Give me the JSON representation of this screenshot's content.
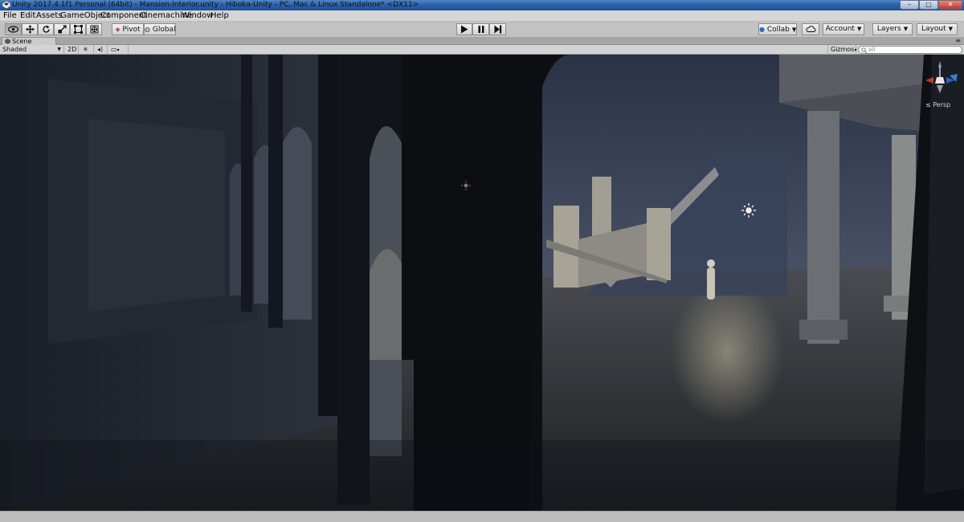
{
  "window": {
    "title": "Unity 2017.4.1f1 Personal (64bit) - Mansion-Interior.unity - Hiboka-Unity - PC, Mac & Linux Standalone* <DX11>",
    "minimize_glyph": "–",
    "maximize_glyph": "□",
    "close_glyph": "✕"
  },
  "menu": [
    "File",
    "Edit",
    "Assets",
    "GameObject",
    "Component",
    "Cinemachine",
    "Window",
    "Help"
  ],
  "toolbar": {
    "tools": [
      {
        "name": "hand-tool",
        "icon": "eye-icon",
        "active": true
      },
      {
        "name": "move-tool",
        "icon": "move-icon",
        "active": false
      },
      {
        "name": "rotate-tool",
        "icon": "rotate-icon",
        "active": false
      },
      {
        "name": "scale-tool",
        "icon": "scale-icon",
        "active": false
      },
      {
        "name": "rect-tool",
        "icon": "rect-icon",
        "active": false
      },
      {
        "name": "transform-tool",
        "icon": "transform-icon",
        "active": false
      }
    ],
    "pivot_label": "Pivot",
    "global_label": "Global",
    "play_icon": "play-icon",
    "pause_icon": "pause-icon",
    "step_icon": "step-icon",
    "collab_label": "Collab",
    "cloud_icon": "cloud-icon",
    "account_label": "Account",
    "layers_label": "Layers",
    "layout_label": "Layout"
  },
  "scene_tab": {
    "label": "Scene",
    "menu_glyph": "≡"
  },
  "scene_bar": {
    "shading_mode": "Shaded",
    "mode_2d_label": "2D",
    "lighting_icon": "sun-icon",
    "audio_icon": "speaker-icon",
    "effects_icon": "image-icon",
    "gizmos_label": "Gizmos",
    "search_placeholder": "All"
  },
  "viewport": {
    "projection_label": "Persp",
    "colors": {
      "background": "#1b1f27",
      "far_wall": "#3a475d",
      "floor": "#3f4248",
      "dark_pillar": "#0d0f13",
      "stone": "#a8a397",
      "glow": "#c8c0a0"
    }
  }
}
